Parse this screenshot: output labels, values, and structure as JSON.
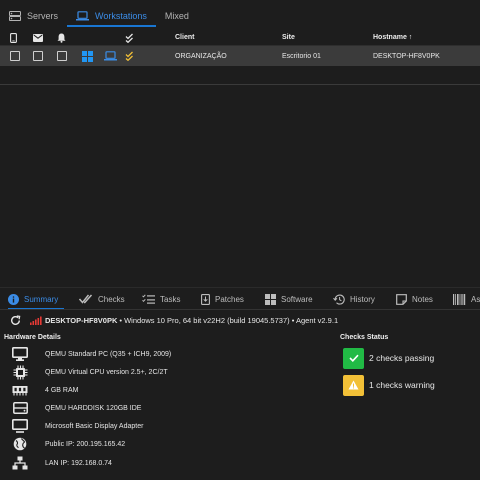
{
  "top_tabs": [
    {
      "label": "Servers",
      "icon": "server-icon"
    },
    {
      "label": "Workstations",
      "icon": "laptop-icon",
      "active": true
    },
    {
      "label": "Mixed",
      "icon": "none"
    }
  ],
  "table": {
    "headers": {
      "client": "Client",
      "site": "Site",
      "hostname": "Hostname ↑"
    },
    "rows": [
      {
        "client": "ORGANIZAÇÃO",
        "site": "Escritorio 01",
        "hostname": "DESKTOP-HF8V0PK"
      }
    ]
  },
  "summary_tabs": [
    {
      "label": "Summary",
      "active": true
    },
    {
      "label": "Checks"
    },
    {
      "label": "Tasks"
    },
    {
      "label": "Patches"
    },
    {
      "label": "Software"
    },
    {
      "label": "History"
    },
    {
      "label": "Notes"
    },
    {
      "label": "As"
    }
  ],
  "agent": {
    "hostname": "DESKTOP-HF8V0PK",
    "details": "• Windows 10 Pro, 64 bit v22H2 (build 19045.5737) • Agent v2.9.1"
  },
  "hardware": {
    "title": "Hardware Details",
    "items": [
      {
        "icon": "monitor-icon",
        "text": "QEMU Standard PC (Q35 + ICH9, 2009)"
      },
      {
        "icon": "cpu-icon",
        "text": "QEMU Virtual CPU version 2.5+, 2C/2T"
      },
      {
        "icon": "memory-icon",
        "text": "4 GB RAM"
      },
      {
        "icon": "disk-icon",
        "text": "QEMU HARDDISK 120GB IDE"
      },
      {
        "icon": "display-icon",
        "text": "Microsoft Basic Display Adapter"
      },
      {
        "icon": "globe-icon",
        "text": "Public IP: 200.195.165.42"
      },
      {
        "icon": "network-icon",
        "text": "LAN IP: 192.168.0.74"
      }
    ]
  },
  "checks": {
    "title": "Checks Status",
    "items": [
      {
        "text": "2 checks passing",
        "color": "#21ba45"
      },
      {
        "text": "1 checks warning",
        "color": "#f2c037"
      }
    ]
  },
  "colors": {
    "accent": "#1976d2",
    "windows_blue": "#2196f3",
    "signal_red": "#e53935"
  }
}
